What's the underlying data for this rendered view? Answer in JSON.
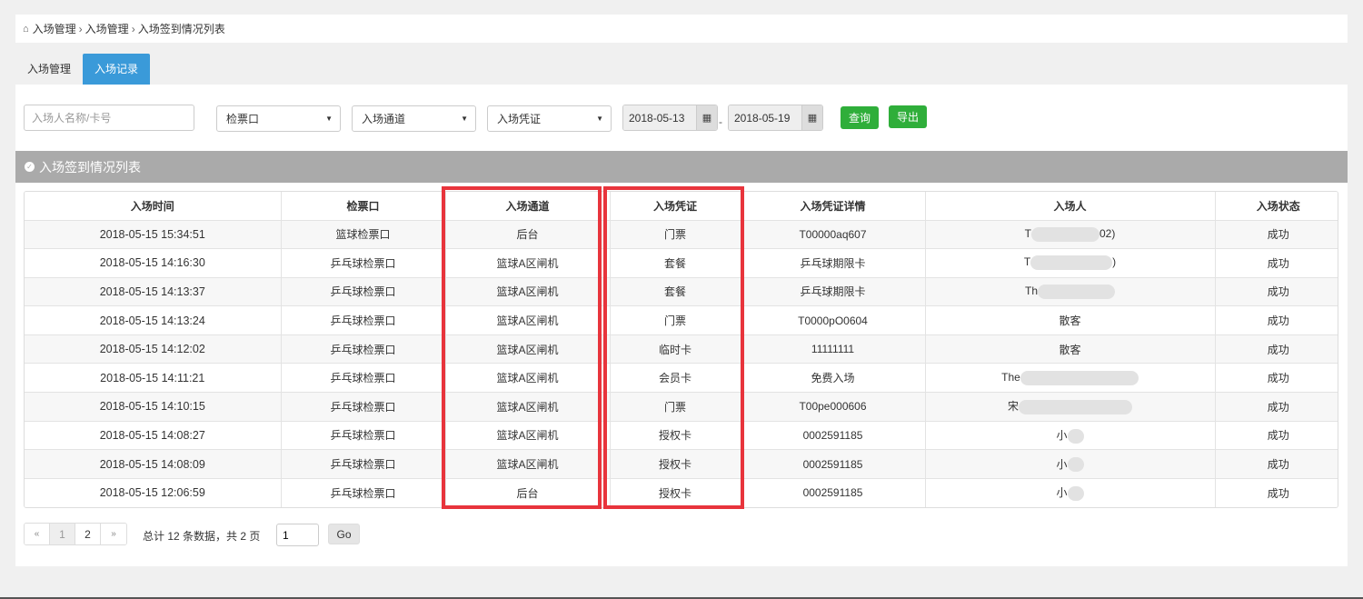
{
  "breadcrumb": {
    "items": [
      "入场管理",
      "入场管理",
      "入场签到情况列表"
    ]
  },
  "tabs": [
    {
      "label": "入场管理",
      "active": false
    },
    {
      "label": "入场记录",
      "active": true
    }
  ],
  "filters": {
    "name_placeholder": "入场人名称/卡号",
    "gate_select": "检票口",
    "channel_select": "入场通道",
    "credential_select": "入场凭证",
    "date_start": "2018-05-13",
    "date_end": "2018-05-19",
    "date_separator": "-",
    "query_button": "查询",
    "export_button": "导出"
  },
  "section": {
    "title": "入场签到情况列表"
  },
  "table": {
    "headers": [
      "入场时间",
      "检票口",
      "入场通道",
      "入场凭证",
      "入场凭证详情",
      "入场人",
      "入场状态"
    ],
    "rows": [
      {
        "time": "2018-05-15 15:34:51",
        "gate": "篮球检票口",
        "channel": "后台",
        "credential": "门票",
        "detail": "T00000aq607",
        "person_a": "T",
        "person_b": "02)",
        "status": "成功"
      },
      {
        "time": "2018-05-15 14:16:30",
        "gate": "乒乓球检票口",
        "channel": "篮球A区闸机",
        "credential": "套餐",
        "detail": "乒乓球期限卡",
        "person_a": "T",
        "person_b": ")",
        "status": "成功"
      },
      {
        "time": "2018-05-15 14:13:37",
        "gate": "乒乓球检票口",
        "channel": "篮球A区闸机",
        "credential": "套餐",
        "detail": "乒乓球期限卡",
        "person_a": "Th",
        "person_b": "",
        "status": "成功"
      },
      {
        "time": "2018-05-15 14:13:24",
        "gate": "乒乓球检票口",
        "channel": "篮球A区闸机",
        "credential": "门票",
        "detail": "T0000pO0604",
        "person_a": "散客",
        "person_b": "",
        "status": "成功"
      },
      {
        "time": "2018-05-15 14:12:02",
        "gate": "乒乓球检票口",
        "channel": "篮球A区闸机",
        "credential": "临时卡",
        "detail": "11111111",
        "person_a": "散客",
        "person_b": "",
        "status": "成功"
      },
      {
        "time": "2018-05-15 14:11:21",
        "gate": "乒乓球检票口",
        "channel": "篮球A区闸机",
        "credential": "会员卡",
        "detail": "免费入场",
        "person_a": "The",
        "person_b": "",
        "status": "成功"
      },
      {
        "time": "2018-05-15 14:10:15",
        "gate": "乒乓球检票口",
        "channel": "篮球A区闸机",
        "credential": "门票",
        "detail": "T00pe000606",
        "person_a": "宋",
        "person_b": "",
        "status": "成功"
      },
      {
        "time": "2018-05-15 14:08:27",
        "gate": "乒乓球检票口",
        "channel": "篮球A区闸机",
        "credential": "授权卡",
        "detail": "0002591185",
        "person_a": "小",
        "person_b": "",
        "status": "成功"
      },
      {
        "time": "2018-05-15 14:08:09",
        "gate": "乒乓球检票口",
        "channel": "篮球A区闸机",
        "credential": "授权卡",
        "detail": "0002591185",
        "person_a": "小",
        "person_b": "",
        "status": "成功"
      },
      {
        "time": "2018-05-15 12:06:59",
        "gate": "乒乓球检票口",
        "channel": "后台",
        "credential": "授权卡",
        "detail": "0002591185",
        "person_a": "小",
        "person_b": "",
        "status": "成功"
      }
    ]
  },
  "pagination": {
    "prev": "«",
    "pages": [
      "1",
      "2"
    ],
    "next": "»",
    "total_text": "总计 12 条数据，共 2 页",
    "page_input_value": "1",
    "go_label": "Go"
  },
  "colors": {
    "accent": "#3a9ad9",
    "success": "#2fae3a",
    "highlight": "#e8343c",
    "header_gray": "#aaaaaa"
  }
}
